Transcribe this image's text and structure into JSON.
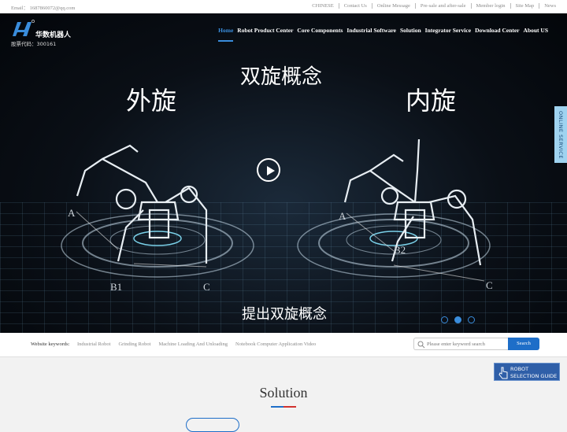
{
  "topbar": {
    "email": "Email： 1687860072@qq.com",
    "links": [
      "CHINESE",
      "Contact Us",
      "Online Message",
      "Pre-sale and after-sale",
      "Member login",
      "Site Map",
      "News"
    ]
  },
  "logo": {
    "name": "华数机器人",
    "stock_code": "股票代码：300161"
  },
  "nav": {
    "items": [
      "Home",
      "Robot Product Center",
      "Core Components",
      "Industrial Software",
      "Solution",
      "Integrator Service",
      "Download Center",
      "About US"
    ],
    "active": "Home"
  },
  "hero": {
    "title_center": "双旋概念",
    "title_left": "外旋",
    "title_right": "内旋",
    "subtitle": "提出双旋概念",
    "labels_left": [
      "A",
      "B1",
      "C"
    ],
    "labels_right": [
      "A",
      "B2",
      "C"
    ],
    "slides": 3,
    "active_slide": 1
  },
  "online_service": "ONLINE SERVICE",
  "keywords": {
    "label": "Website keywords:",
    "items": [
      "Industrial Robot",
      "Grinding Robot",
      "Machine Loading And Unloading",
      "Notebook Computer Application Video"
    ]
  },
  "search": {
    "placeholder": "Please enter keyword search",
    "button": "Search"
  },
  "robot_selection": {
    "line1": "ROBOT",
    "line2": "SELECTION GUIDE"
  },
  "section": {
    "title": "Solution"
  },
  "colors": {
    "accent": "#1e6ec8",
    "nav_active": "#3a8ddc",
    "red": "#d0322f"
  }
}
